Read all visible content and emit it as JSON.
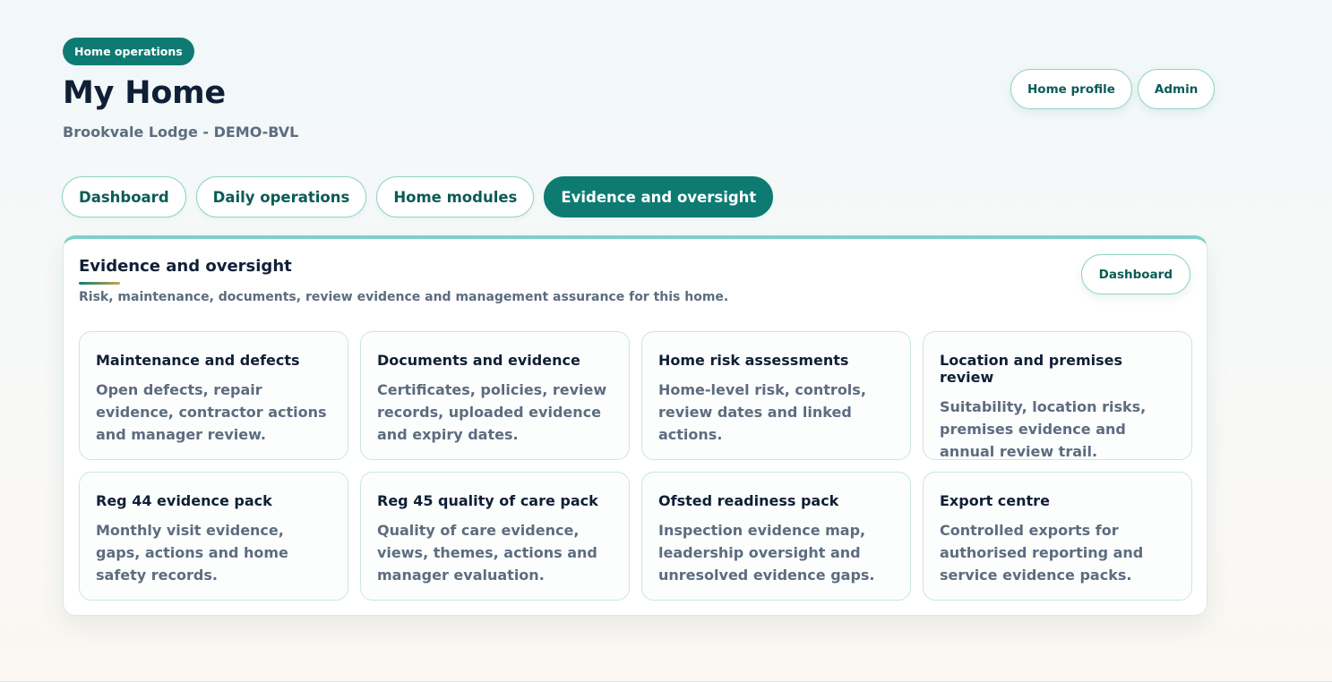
{
  "header": {
    "badge": "Home operations",
    "title": "My Home",
    "subtitle": "Brookvale Lodge - DEMO-BVL",
    "actions": [
      "Home profile",
      "Admin"
    ]
  },
  "tabs": [
    {
      "label": "Dashboard",
      "active": false
    },
    {
      "label": "Daily operations",
      "active": false
    },
    {
      "label": "Home modules",
      "active": false
    },
    {
      "label": "Evidence and oversight",
      "active": true
    }
  ],
  "panel": {
    "title": "Evidence and oversight",
    "description": "Risk, maintenance, documents, review evidence and management assurance for this home.",
    "button": "Dashboard",
    "cards": [
      {
        "title": "Maintenance and defects",
        "description": "Open defects, repair evidence, contractor actions and manager review."
      },
      {
        "title": "Documents and evidence",
        "description": "Certificates, policies, review records, uploaded evidence and expiry dates."
      },
      {
        "title": "Home risk assessments",
        "description": "Home-level risk, controls, review dates and linked actions."
      },
      {
        "title": "Location and premises review",
        "description": "Suitability, location risks, premises evidence and annual review trail."
      },
      {
        "title": "Reg 44 evidence pack",
        "description": "Monthly visit evidence, gaps, actions and home safety records."
      },
      {
        "title": "Reg 45 quality of care pack",
        "description": "Quality of care evidence, views, themes, actions and manager evaluation."
      },
      {
        "title": "Ofsted readiness pack",
        "description": "Inspection evidence map, leadership oversight and unresolved evidence gaps."
      },
      {
        "title": "Export centre",
        "description": "Controlled exports for authorised reporting and service evidence packs."
      }
    ]
  },
  "colors": {
    "brand_teal": "#0e7b73",
    "heading_text": "#0f1f36",
    "muted_text": "#5d6c7f",
    "border_mint": "#8fd3c8"
  }
}
